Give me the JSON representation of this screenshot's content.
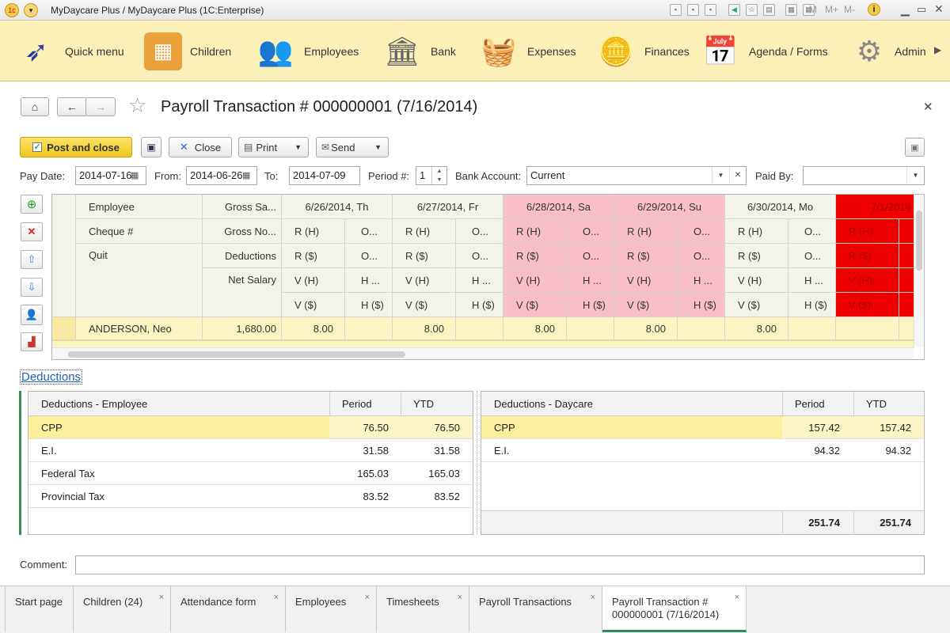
{
  "window": {
    "title": "MyDaycare Plus / MyDaycare Plus  (1C:Enterprise)"
  },
  "menu": [
    {
      "label": "Quick menu",
      "icon": "paper-plane-logo-icon"
    },
    {
      "label": "Children",
      "icon": "toy-blocks-icon"
    },
    {
      "label": "Employees",
      "icon": "people-icon"
    },
    {
      "label": "Bank",
      "icon": "bank-building-icon"
    },
    {
      "label": "Expenses",
      "icon": "shopping-basket-icon"
    },
    {
      "label": "Finances",
      "icon": "coins-icon"
    },
    {
      "label": "Agenda / Forms",
      "icon": "calendar-clock-icon"
    },
    {
      "label": "Admin",
      "icon": "gear-icon"
    }
  ],
  "form": {
    "title": "Payroll Transaction # 000000001 (7/16/2014)",
    "post_close": "Post and close",
    "close": "Close",
    "print": "Print",
    "send": "Send",
    "pay_date_label": "Pay Date:",
    "pay_date": "2014-07-16",
    "from_label": "From:",
    "from": "2014-06-26",
    "to_label": "To:",
    "to": "2014-07-09",
    "period_label": "Period #:",
    "period": "1",
    "bank_label": "Bank Account:",
    "bank": "Current",
    "paid_by_label": "Paid By:",
    "paid_by": ""
  },
  "grid": {
    "col_employee": "Employee",
    "col_cheque": "Cheque #",
    "col_quit": "Quit",
    "col_gross_sa": "Gross Sa...",
    "col_gross_no": "Gross No...",
    "col_deductions": "Deductions",
    "col_net": "Net Salary",
    "days": [
      {
        "date": "6/26/2014, Th",
        "weekend": false
      },
      {
        "date": "6/27/2014, Fr",
        "weekend": false
      },
      {
        "date": "6/28/2014, Sa",
        "weekend": true
      },
      {
        "date": "6/29/2014, Su",
        "weekend": true
      },
      {
        "date": "6/30/2014, Mo",
        "weekend": false
      },
      {
        "date": "7/1/2014",
        "weekend": false
      }
    ],
    "sub": {
      "rh": "R (H)",
      "o": "O...",
      "rs": "R ($)",
      "vh": "V (H)",
      "h": "H ...",
      "vs": "V ($)",
      "hs": "H ($)"
    },
    "row": {
      "employee": "ANDERSON, Neo",
      "gross": "1,680.00",
      "hours": [
        "8.00",
        "8.00",
        "8.00",
        "8.00",
        "8.00",
        ""
      ]
    }
  },
  "deductions": {
    "link": "Deductions",
    "employee": {
      "header": "Deductions - Employee",
      "period": "Period",
      "ytd": "YTD",
      "rows": [
        {
          "name": "CPP",
          "period": "76.50",
          "ytd": "76.50"
        },
        {
          "name": "E.I.",
          "period": "31.58",
          "ytd": "31.58"
        },
        {
          "name": "Federal Tax",
          "period": "165.03",
          "ytd": "165.03"
        },
        {
          "name": "Provincial Tax",
          "period": "83.52",
          "ytd": "83.52"
        }
      ]
    },
    "daycare": {
      "header": "Deductions - Daycare",
      "period": "Period",
      "ytd": "YTD",
      "rows": [
        {
          "name": "CPP",
          "period": "157.42",
          "ytd": "157.42"
        },
        {
          "name": "E.I.",
          "period": "94.32",
          "ytd": "94.32"
        }
      ],
      "total_period": "251.74",
      "total_ytd": "251.74"
    }
  },
  "comment": {
    "label": "Comment:",
    "value": ""
  },
  "tabs": [
    {
      "label": "Start page",
      "closable": false
    },
    {
      "label": "Children (24)",
      "closable": true
    },
    {
      "label": "Attendance form",
      "closable": true
    },
    {
      "label": "Employees",
      "closable": true
    },
    {
      "label": "Timesheets",
      "closable": true
    },
    {
      "label": "Payroll Transactions",
      "closable": true
    },
    {
      "label": "Payroll Transaction # 000000001 (7/16/2014)",
      "closable": true,
      "active": true
    }
  ]
}
